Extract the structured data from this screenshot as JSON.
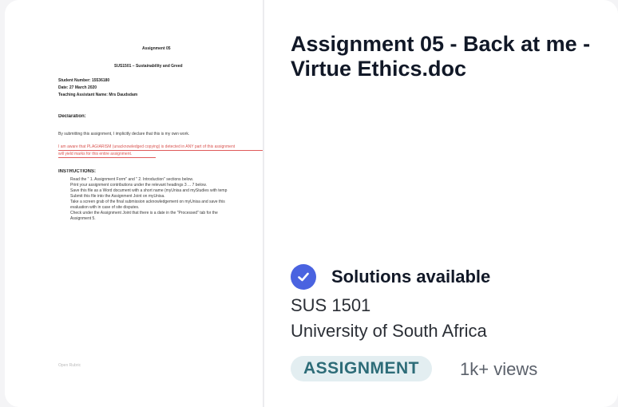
{
  "document": {
    "title": "Assignment 05 - Back at me - Virtue Ethics.doc",
    "solutions_label": "Solutions available",
    "course_code": "SUS 1501",
    "university": "University of South Africa",
    "type_badge": "ASSIGNMENT",
    "views": "1k+ views",
    "accent_color": "#4a63e0"
  },
  "preview": {
    "heading": "Assignment 05",
    "subheading": "SUS1501 – Sustainability and Greed",
    "student_number": "Student Number: 15536180",
    "date": "Date: 27 March 2020",
    "assistant": "Teaching Assistant Name: Mrs Daudsdam",
    "declaration_heading": "Declaration:",
    "declaration_text": "By submitting this assignment, I implicitly declare that this is my own work.",
    "red_line_1": "I am aware that PLAGIARISM (unacknowledged copying) is detected in ANY part of this assignment",
    "red_line_2": "will yield marks for this entire assignment.",
    "instructions_heading": "INSTRUCTIONS:",
    "bullets": [
      "Read the \" 1. Assignment Form\" and \" 2. Introduction\" sections below.",
      "Print your assignment contributions under the relevant headings 3 ... 7 below.",
      "Save this file as a Word document with a short name (myUnisa and myStudies with temp",
      "Submit this file into the Assignment Joint on myUnisa.",
      "Take a screen grab of the final submission acknowledgement on myUnisa and save this",
      "evaluation with in case of site disputes.",
      "Check under the Assignment Joint that there is a date in the \"Processed\" tab for the  ",
      "Assignment 5."
    ],
    "footer": "Open Rubric"
  }
}
